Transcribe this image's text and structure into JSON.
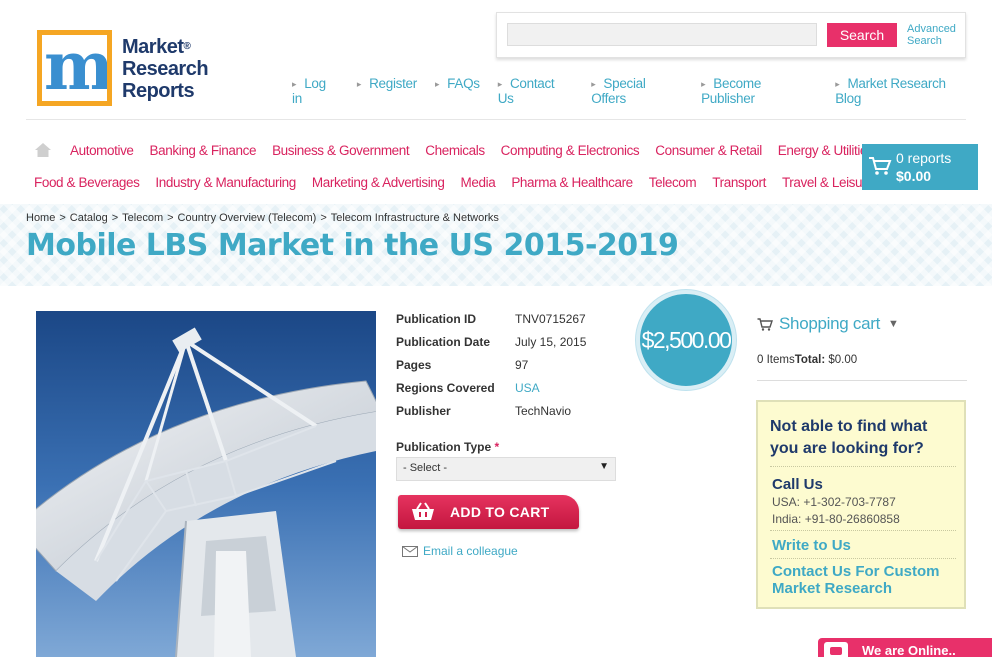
{
  "brand": {
    "line1": "Market",
    "line2": "Research",
    "line3": "Reports",
    "reg": "®"
  },
  "search": {
    "value": "",
    "placeholder": "",
    "button_label": "Search",
    "advanced_line1": "Advanced",
    "advanced_line2": "Search"
  },
  "top_links": [
    "Log in",
    "Register",
    "FAQs",
    "Contact Us",
    "Special Offers",
    "Become Publisher",
    "Market Research Blog"
  ],
  "categories_row1": [
    "Automotive",
    "Banking & Finance",
    "Business & Government",
    "Chemicals",
    "Computing & Electronics",
    "Consumer & Retail",
    "Energy & Utilities"
  ],
  "categories_row2": [
    "Food & Beverages",
    "Industry & Manufacturing",
    "Marketing & Advertising",
    "Media",
    "Pharma & Healthcare",
    "Telecom",
    "Transport",
    "Travel & Leisure"
  ],
  "cart_box": {
    "reports": "0 reports",
    "total": "$0.00"
  },
  "breadcrumb": [
    "Home",
    "Catalog",
    "Telecom",
    "Country Overview (Telecom)",
    "Telecom Infrastructure & Networks"
  ],
  "breadcrumb_sep": ">",
  "page_title": "Mobile LBS Market in the US 2015-2019",
  "details": {
    "pub_id_label": "Publication ID",
    "pub_id": "TNV0715267",
    "pub_date_label": "Publication Date",
    "pub_date": "July 15, 2015",
    "pages_label": "Pages",
    "pages": "97",
    "regions_label": "Regions Covered",
    "regions": "USA",
    "publisher_label": "Publisher",
    "publisher": "TechNavio"
  },
  "pub_type": {
    "label": "Publication Type",
    "required": "*",
    "selected": "- Select -"
  },
  "add_to_cart": "ADD TO CART",
  "email_link": "Email a colleague",
  "price": "$2,500.00",
  "shopping_cart": {
    "title": "Shopping cart",
    "items": "0 Items",
    "total_label": "Total:",
    "total": "$0.00"
  },
  "help_box": {
    "title": "Not able to find what you are looking for?",
    "call_us": "Call Us",
    "usa_phone": "USA: +1-302-703-7787",
    "india_phone": "India: +91-80-26860858",
    "write_to_us": "Write to Us",
    "contact_custom": "Contact Us For Custom Market Research"
  },
  "chat": {
    "label": "We are Online.."
  },
  "colors": {
    "accent": "#3fa9c5",
    "category": "#d9235f",
    "button": "#e8306a",
    "logo_orange": "#f5a623",
    "logo_navy": "#1f3a6b"
  }
}
